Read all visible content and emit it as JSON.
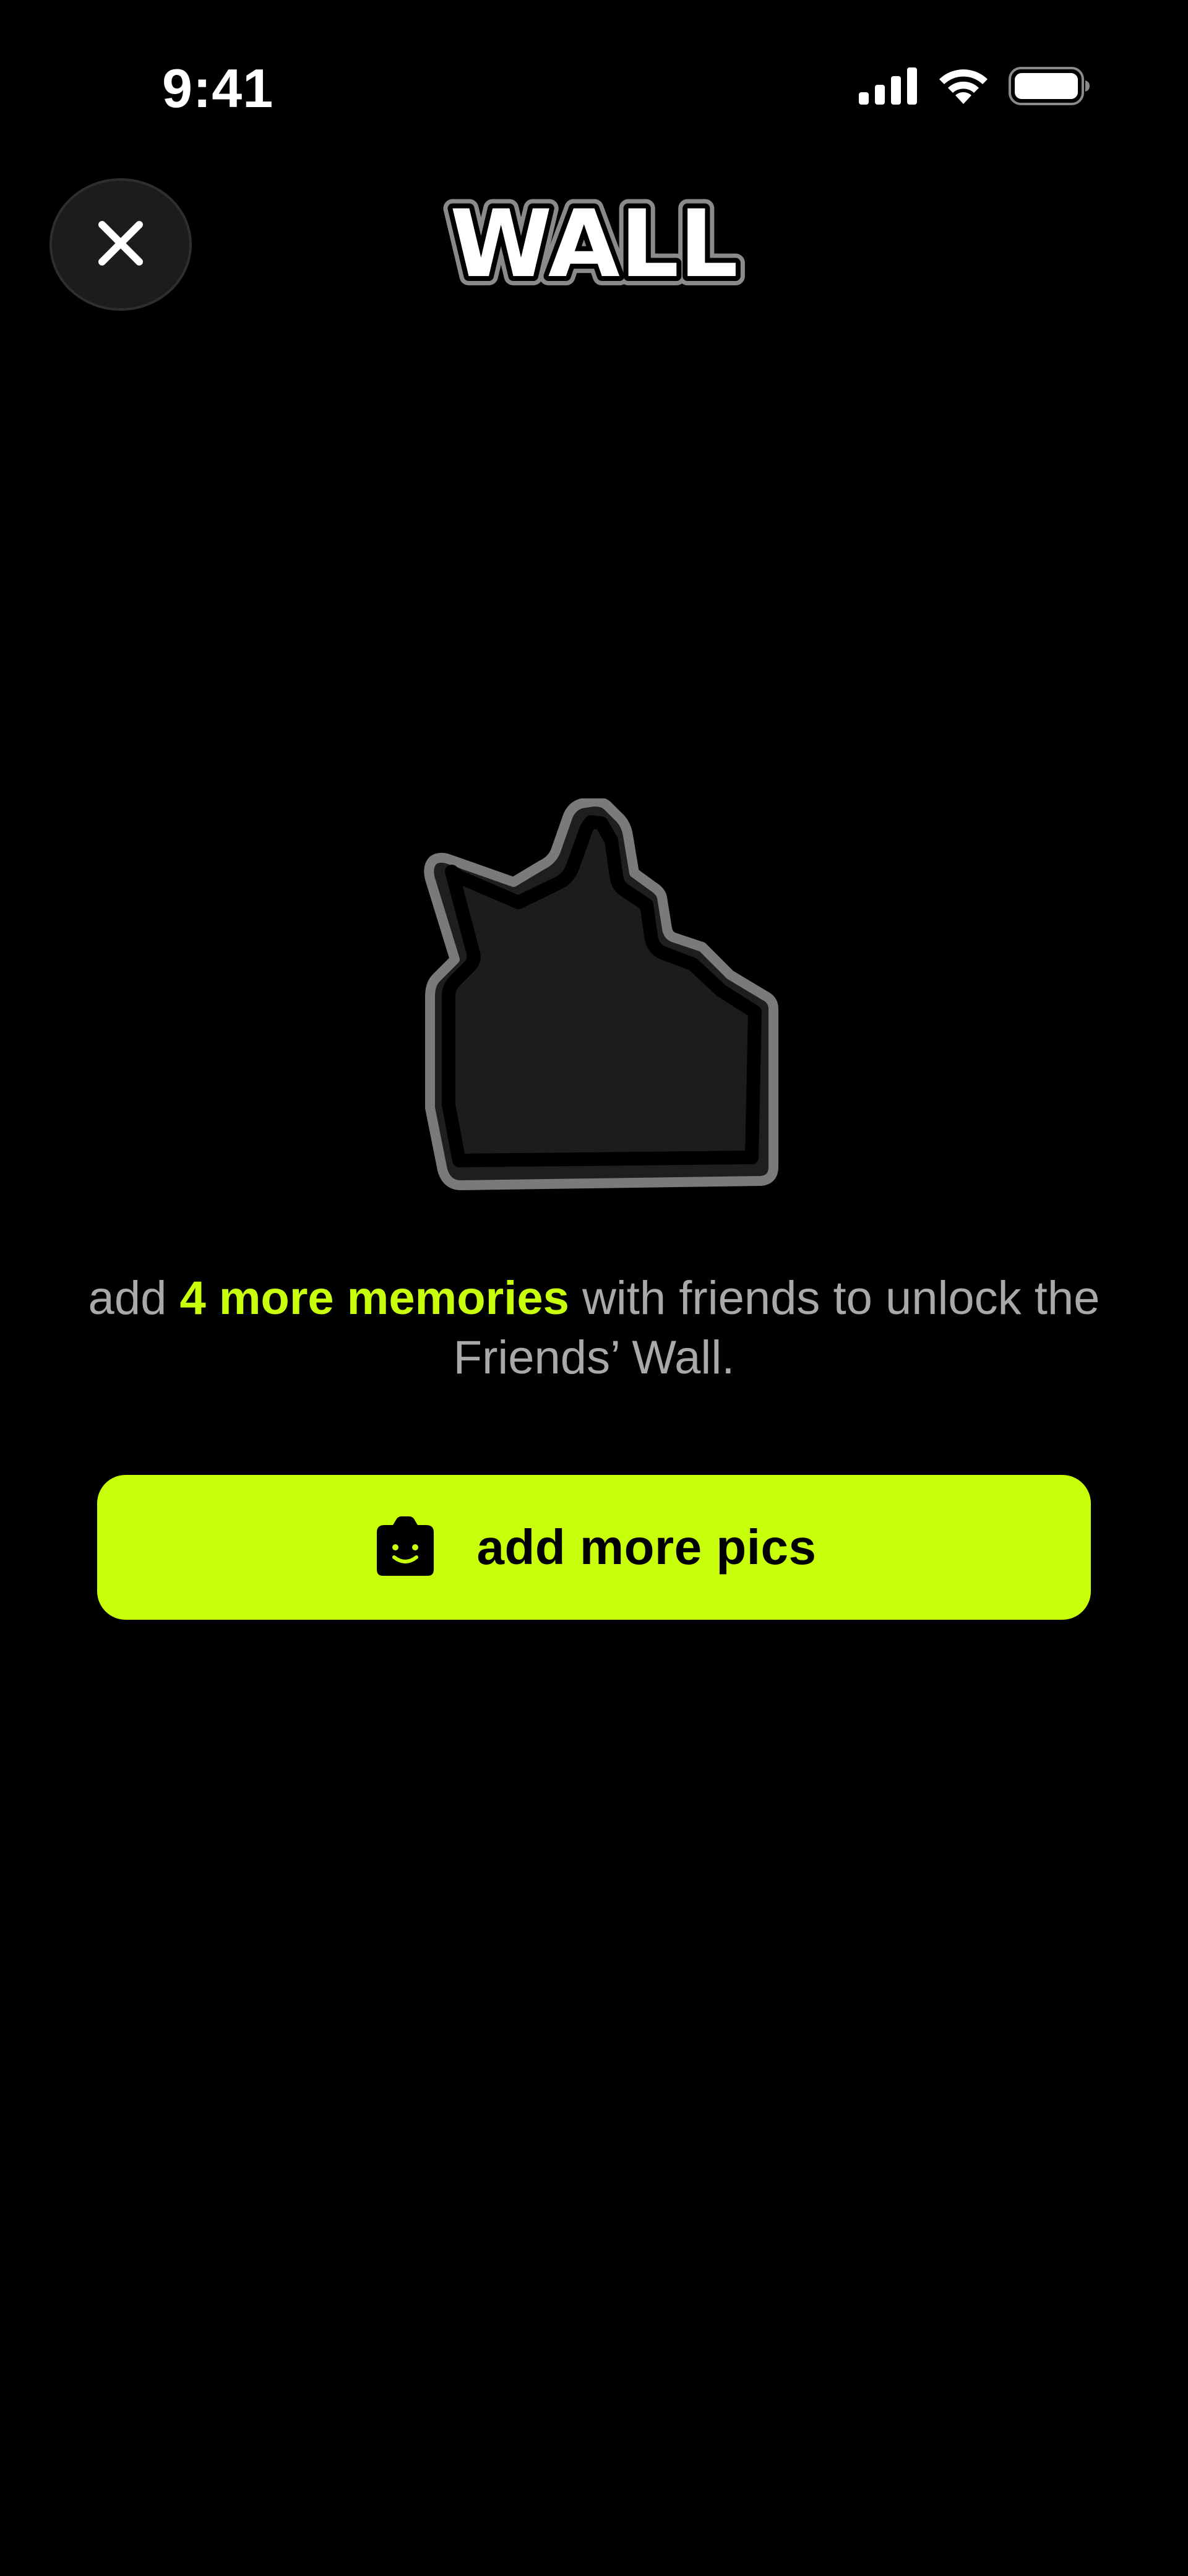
{
  "status_bar": {
    "time": "9:41",
    "icons": [
      "cellular-signal-icon",
      "wifi-icon",
      "battery-icon"
    ]
  },
  "header": {
    "close_icon": "close-icon",
    "logo_text": "WALL"
  },
  "illustration": {
    "icon": "locked-wall-placeholder-icon"
  },
  "message": {
    "prefix": "add ",
    "highlight": "4 more memories",
    "suffix": " with friends to unlock the Friends’ Wall."
  },
  "cta": {
    "label": "add more pics",
    "icon": "camera-smile-icon"
  },
  "colors": {
    "background": "#000000",
    "accent": "#c8ff0a",
    "muted_text": "#a9a9a9",
    "close_button_bg": "#1c1c1c",
    "placeholder_fill": "#1e1e1e",
    "placeholder_stroke": "#7a7a7a"
  }
}
